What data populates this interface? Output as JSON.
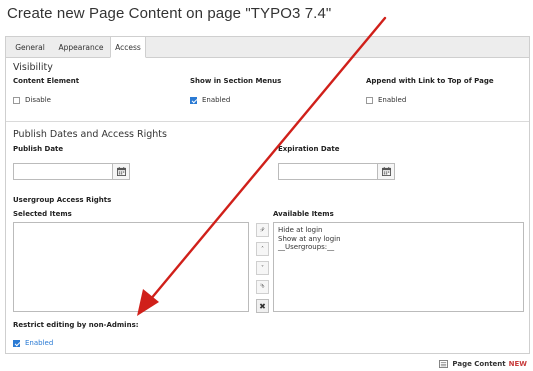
{
  "page_title": "Create new Page Content on page \"TYPO3 7.4\"",
  "tabs": [
    {
      "label": "General",
      "active": false
    },
    {
      "label": "Appearance",
      "active": false
    },
    {
      "label": "Access",
      "active": true
    }
  ],
  "visibility": {
    "title": "Visibility",
    "content_element": {
      "label": "Content Element",
      "option": "Disable",
      "checked": false
    },
    "section_menus": {
      "label": "Show in Section Menus",
      "option": "Enabled",
      "checked": true
    },
    "top_link": {
      "label": "Append with Link to Top of Page",
      "option": "Enabled",
      "checked": false
    }
  },
  "publish": {
    "title": "Publish Dates and Access Rights",
    "publish_date_label": "Publish Date",
    "publish_date_value": "",
    "expiration_date_label": "Expiration Date",
    "expiration_date_value": ""
  },
  "usergroup": {
    "label": "Usergroup Access Rights",
    "selected_label": "Selected Items",
    "available_label": "Available Items",
    "selected_items": [],
    "available_items": [
      "Hide at login",
      "Show at any login",
      "__Usergroups:__"
    ]
  },
  "restrict": {
    "label": "Restrict editing by non-Admins:",
    "option": "Enabled",
    "checked": true
  },
  "footer": {
    "type_label": "Page Content",
    "new_label": "NEW"
  },
  "colors": {
    "accent_blue": "#2b7bd4",
    "annotation_red": "#d0201a",
    "new_red": "#c83c3c"
  },
  "icons": [
    "calendar-icon",
    "move-top-icon",
    "move-up-icon",
    "move-down-icon",
    "move-bottom-icon",
    "remove-icon",
    "content-element-icon"
  ]
}
